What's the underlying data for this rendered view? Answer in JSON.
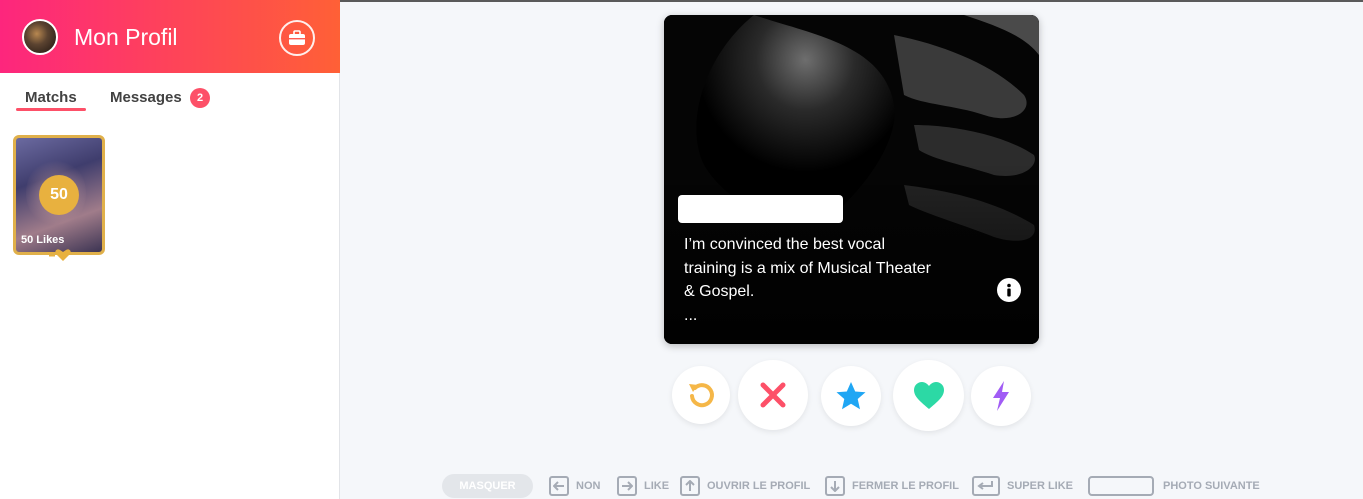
{
  "header": {
    "title": "Mon Profil",
    "avatar_icon": "profile-avatar",
    "action_icon": "briefcase-icon"
  },
  "tabs": {
    "matches": "Matchs",
    "messages": "Messages",
    "messages_badge": "2"
  },
  "likes_card": {
    "count": "50",
    "label": "50 Likes"
  },
  "card": {
    "bio": "I’m convinced the best vocal\ntraining is a mix of Musical Theater\n& Gospel.\n...",
    "info_icon": "info-icon"
  },
  "actions": [
    {
      "name": "rewind",
      "icon": "rewind-icon",
      "color": "#f5b748"
    },
    {
      "name": "nope",
      "icon": "close-icon",
      "color": "#fd5068"
    },
    {
      "name": "super-like",
      "icon": "star-icon",
      "color": "#1fa6f4"
    },
    {
      "name": "like",
      "icon": "heart-icon",
      "color": "#2cd9a5"
    },
    {
      "name": "boost",
      "icon": "lightning-icon",
      "color": "#a15cf5"
    }
  ],
  "hints": {
    "hide": "MASQUER",
    "nope": "NON",
    "like": "LIKE",
    "open_profile": "OUVRIR LE PROFIL",
    "close_profile": "FERMER LE PROFIL",
    "super_like": "SUPER LIKE",
    "next_photo": "PHOTO SUIVANTE"
  },
  "colors": {
    "brand_start": "#fd267d",
    "brand_end": "#ff6036",
    "gold": "#e8b13f",
    "accent_red": "#fd5068"
  }
}
